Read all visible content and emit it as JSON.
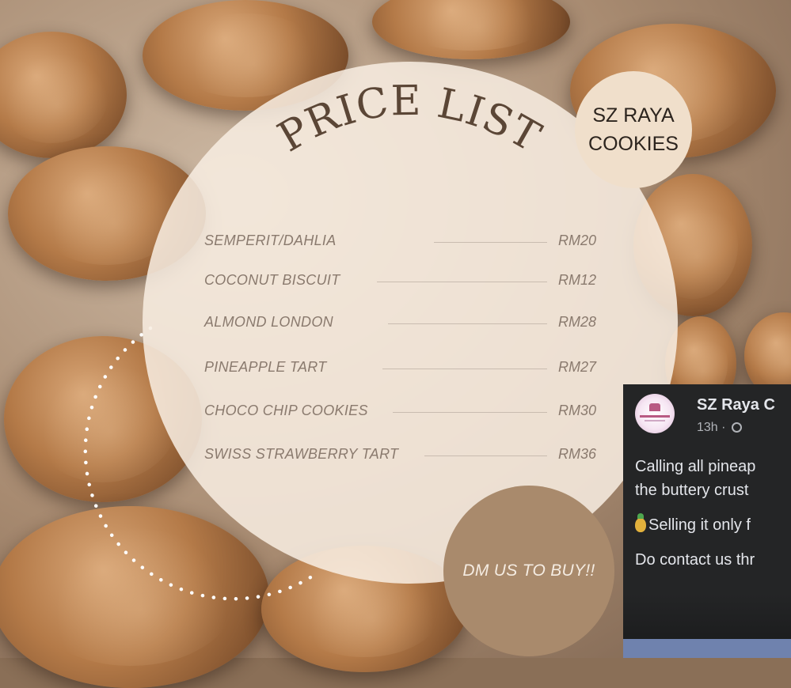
{
  "poster": {
    "title": "PRICE LIST",
    "brand_line1": "SZ RAYA",
    "brand_line2": "COOKIES",
    "cta": "DM US TO BUY!!",
    "items": [
      {
        "name": "SEMPERIT/DAHLIA",
        "price": "RM20"
      },
      {
        "name": "COCONUT BISCUIT",
        "price": "RM12"
      },
      {
        "name": "ALMOND LONDON",
        "price": "RM28"
      },
      {
        "name": "PINEAPPLE TART",
        "price": "RM27"
      },
      {
        "name": "CHOCO CHIP COOKIES",
        "price": "RM30"
      },
      {
        "name": "SWISS STRAWBERRY TART",
        "price": "RM36"
      }
    ]
  },
  "facebook_post": {
    "page_name": "SZ Raya C",
    "time": "13h ·",
    "line1": "Calling all pineap",
    "line2": "the buttery crust",
    "line3": "Selling it only f",
    "line4": "Do contact us thr",
    "icons": {
      "privacy": "globe-icon",
      "emoji": "pineapple-icon"
    }
  },
  "colors": {
    "title": "#5b4636",
    "item_text": "#8a7a6e",
    "fb_bg": "#242526",
    "dm_circle": "#a98a6c"
  }
}
